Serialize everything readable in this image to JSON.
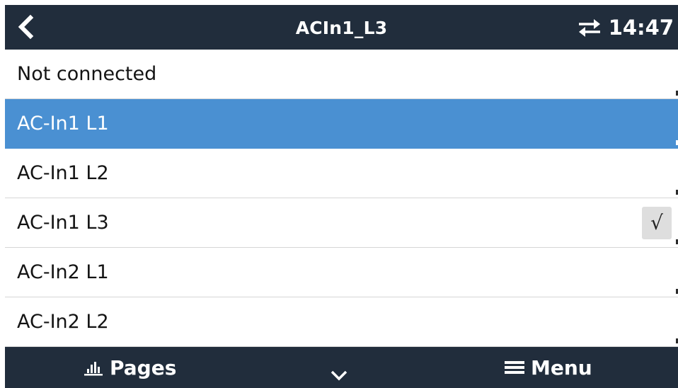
{
  "header": {
    "title": "ACIn1_L3",
    "time": "14:47",
    "back_icon": "chevron-left-icon",
    "connection_icon": "swap-arrows-icon"
  },
  "options": {
    "items": [
      {
        "label": "Not connected"
      },
      {
        "label": "AC-In1 L1"
      },
      {
        "label": "AC-In1 L2"
      },
      {
        "label": "AC-In1 L3"
      },
      {
        "label": "AC-In2 L1"
      },
      {
        "label": "AC-In2 L2"
      }
    ],
    "highlighted": "AC-In1 L1",
    "checked": "AC-In1 L3",
    "check_mark": "√"
  },
  "footer": {
    "pages_label": "Pages",
    "menu_label": "Menu",
    "pages_icon": "bar-chart-icon",
    "scroll_icon": "chevron-down-icon",
    "menu_icon": "hamburger-icon"
  },
  "colors": {
    "bar_background": "#212d3c",
    "highlight": "#4a90d2",
    "check_background": "#dedede"
  }
}
